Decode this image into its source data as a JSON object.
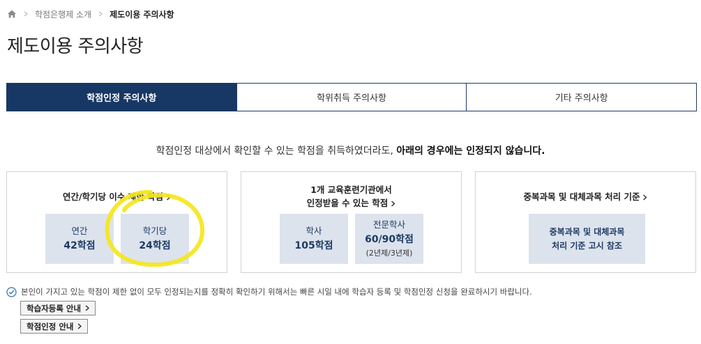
{
  "breadcrumb": {
    "items": [
      "학점은행제 소개",
      "제도이용 주의사항"
    ]
  },
  "page_title": "제도이용 주의사항",
  "tabs": [
    {
      "label": "학점인정 주의사항",
      "active": true
    },
    {
      "label": "학위취득 주의사항",
      "active": false
    },
    {
      "label": "기타 주의사항",
      "active": false
    }
  ],
  "notice": {
    "text": "학점인정 대상에서 확인할 수 있는 학점을 취득하였더라도, ",
    "bold": "아래의 경우에는 인정되지 않습니다."
  },
  "cards": [
    {
      "title": "연간/학기당 이수 제한 학점",
      "boxes": [
        {
          "label": "연간",
          "value": "42학점"
        },
        {
          "label": "학기당",
          "value": "24학점"
        }
      ]
    },
    {
      "title_line1": "1개 교육훈련기관에서",
      "title_line2": "인정받을 수 있는 학점",
      "boxes": [
        {
          "label": "학사",
          "value": "105학점"
        },
        {
          "label": "전문학사",
          "value": "60/90학점",
          "note": "(2년제/3년제)"
        }
      ]
    },
    {
      "title": "중복과목 및 대체과목 처리 기준",
      "boxes": [
        {
          "line1": "중복과목 및 대체과목",
          "line2": "처리 기준 고시 참조"
        }
      ]
    }
  ],
  "check_notice": "본인이 가지고 있는 학점이 제한 없이 모두 인정되는지를 정확히 확인하기 위해서는 빠른 시일 내에 학습자 등록 및 학점인정 신청을 완료하시기 바랍니다.",
  "buttons": {
    "register": "학습자등록 안내",
    "credit": "학점인정 안내"
  },
  "colors": {
    "primary": "#173764",
    "box_bg": "#dce3ed",
    "highlight": "#f5e61a",
    "check": "#2a6fb5"
  }
}
